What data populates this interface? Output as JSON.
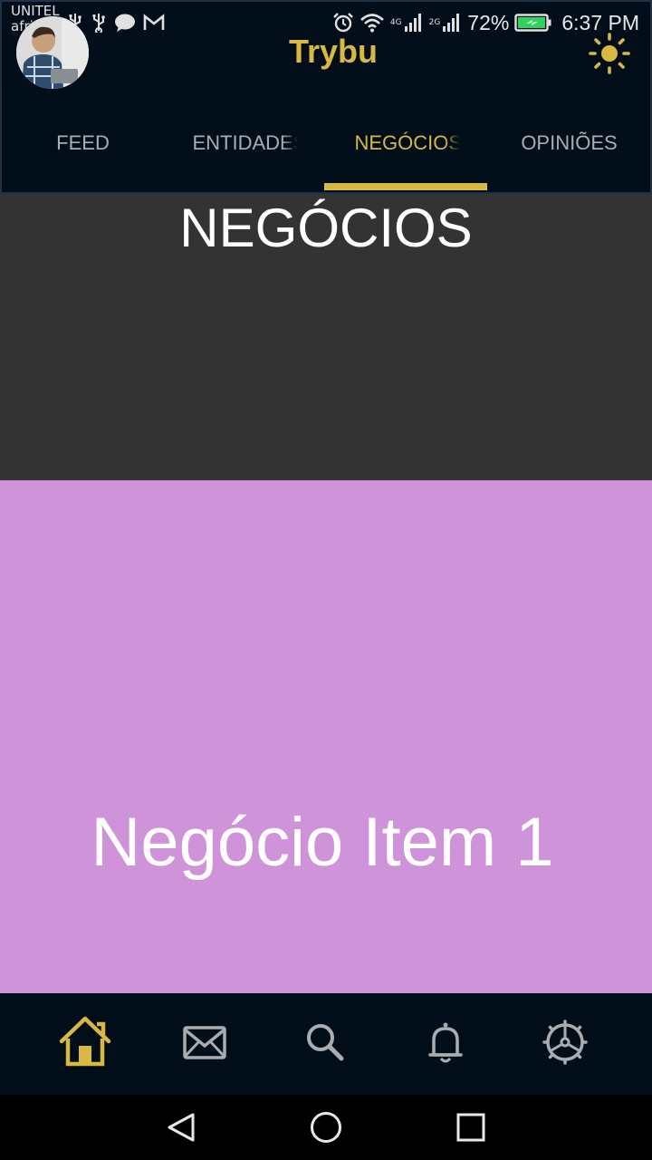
{
  "status_bar": {
    "carrier_1": "UNITEL",
    "carrier_2": "africell",
    "network_1": "4G",
    "network_2": "2G",
    "battery_percent": "72%",
    "time": "6:37 PM",
    "icons": [
      "usb-icon",
      "usb-icon",
      "chat-icon",
      "gmail-icon",
      "alarm-icon",
      "wifi-icon",
      "signal-icon",
      "signal-icon",
      "battery-charging-icon"
    ]
  },
  "app_bar": {
    "title": "Trybu",
    "avatar": "user-avatar",
    "theme_icon": "sun-icon"
  },
  "tabs": [
    {
      "label": "FEED",
      "active": false
    },
    {
      "label": "ENTIDADES",
      "active": false
    },
    {
      "label": "NEGÓCIOS",
      "active": true
    },
    {
      "label": "OPINIÕES",
      "active": false
    }
  ],
  "content": {
    "heading": "NEGÓCIOS",
    "items": [
      {
        "title": "Negócio Item 1",
        "color": "#ce93d8"
      }
    ]
  },
  "bottom_nav": {
    "items": [
      {
        "icon": "home-icon",
        "active": true
      },
      {
        "icon": "mail-icon",
        "active": false
      },
      {
        "icon": "search-icon",
        "active": false
      },
      {
        "icon": "bell-icon",
        "active": false
      },
      {
        "icon": "settings-icon",
        "active": false
      }
    ]
  },
  "system_nav": [
    "back-icon",
    "home-circle-icon",
    "recents-icon"
  ],
  "colors": {
    "accent": "#d8b743",
    "header_bg": "#010e1a",
    "content_bg": "#333333",
    "card_bg": "#ce93d8",
    "inactive": "#a9adb1"
  }
}
